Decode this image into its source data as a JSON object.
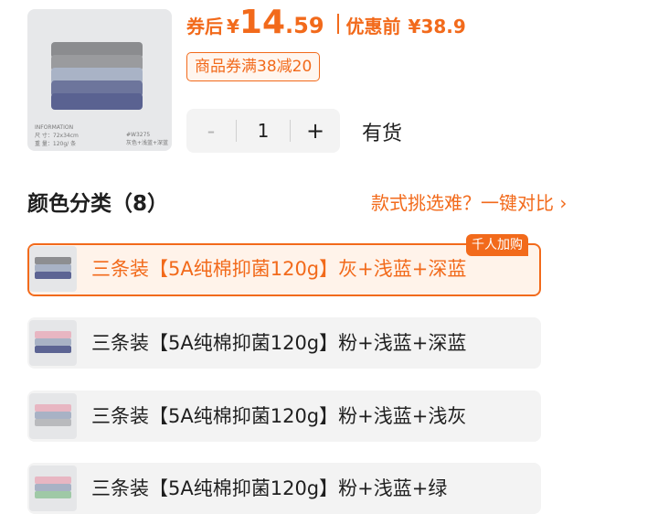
{
  "product": {
    "image_tag_info": "INFORMATION",
    "image_tag_size": "尺 寸：72x34cm",
    "image_tag_weight": "重 量：120g/ 条",
    "image_tag_code": "#W3275",
    "image_tag_colors": "灰色+浅蓝+深蓝"
  },
  "price": {
    "coupon_label": "券后",
    "currency": "¥",
    "integer": "14",
    "decimal": ".59",
    "original_label": "优惠前",
    "original": "¥38.9",
    "coupon_badge": "商品券满38减20"
  },
  "quantity": {
    "minus": "-",
    "value": "1",
    "plus": "+",
    "stock_status": "有货"
  },
  "variants_section": {
    "title": "颜色分类（8）",
    "compare_link": "款式挑选难？一键对比 ›",
    "hot_tag": "千人加购",
    "items": [
      {
        "label": "三条装【5A纯棉抑菌120g】灰+浅蓝+深蓝"
      },
      {
        "label": "三条装【5A纯棉抑菌120g】粉+浅蓝+深蓝"
      },
      {
        "label": "三条装【5A纯棉抑菌120g】粉+浅蓝+浅灰"
      },
      {
        "label": "三条装【5A纯棉抑菌120g】粉+浅蓝+绿"
      }
    ]
  },
  "colors": {
    "accent": "#f26a1b",
    "selected_bg": "#fff3ea",
    "item_bg": "#f3f3f3"
  }
}
